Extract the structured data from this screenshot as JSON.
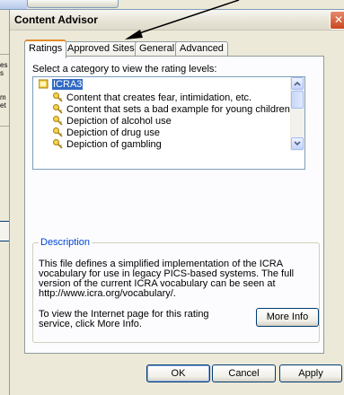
{
  "background": {
    "fragments": [
      "es",
      "s",
      "m",
      "et"
    ]
  },
  "dialog": {
    "title": "Content Advisor",
    "close_glyph": "✕",
    "tabs": [
      "Ratings",
      "Approved Sites",
      "General",
      "Advanced"
    ],
    "active_tab": "Ratings",
    "category_label": "Select a category to view the rating levels:",
    "list": {
      "root": "ICRA3",
      "items": [
        "Content that creates fear, intimidation, etc.",
        "Content that sets a bad example for young children",
        "Depiction of alcohol use",
        "Depiction of drug use",
        "Depiction of gambling"
      ]
    },
    "description": {
      "legend": "Description",
      "text": "This file defines a simplified implementation of the ICRA vocabulary for use in legacy PICS-based systems. The full version of the current ICRA vocabulary can be seen at http://www.icra.org/vocabulary/.",
      "info_text": "To view the Internet page for this rating service, click More Info.",
      "more_info_label": "More Info"
    },
    "buttons": {
      "ok": "OK",
      "cancel": "Cancel",
      "apply": "Apply"
    }
  },
  "colors": {
    "selection": "#316ac5",
    "group_legend": "#0046d5",
    "active_tab_accent": "#e68b2c",
    "icon": "key-icon"
  }
}
